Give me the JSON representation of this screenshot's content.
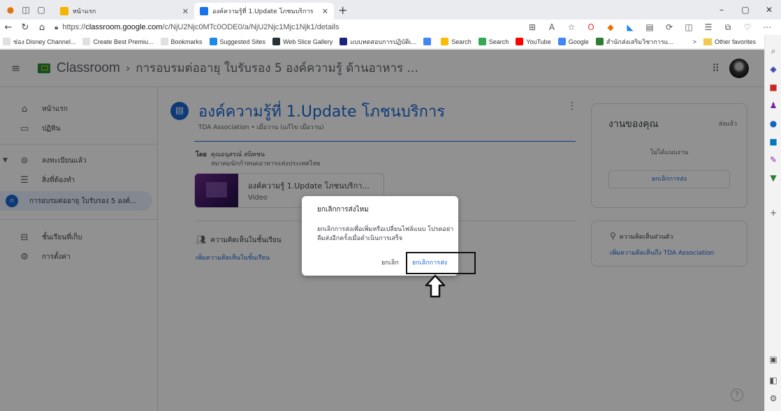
{
  "browser": {
    "tabs": [
      {
        "title": "หน้าแรก",
        "active": false,
        "color": "#f4b400"
      },
      {
        "title": "องค์ความรู้ที่ 1.Update โภชนบริการ",
        "active": true,
        "color": "#1a73e8"
      }
    ],
    "new_tab": "+",
    "url_prefix": "https://",
    "url_host": "classroom.google.com",
    "url_path": "/c/NjU2Njc0MTc0ODE0/a/NjU2Njc1Mjc1Njk1/details",
    "favorites": [
      {
        "label": "ช่อง Disney Channel...",
        "color": "#e0e0e0"
      },
      {
        "label": "Create Best Premiu...",
        "color": "#e0e0e0"
      },
      {
        "label": "Bookmarks",
        "color": "#e0e0e0"
      },
      {
        "label": "Suggested Sites",
        "color": "#1e88e5"
      },
      {
        "label": "Web Slice Gallery",
        "color": "#263238"
      },
      {
        "label": "แบบทดสอบการปฏิบัติเ...",
        "color": "#1a237e"
      },
      {
        "label": "",
        "color": "#4285f4"
      },
      {
        "label": "Search",
        "color": "#fbbc04"
      },
      {
        "label": "Search",
        "color": "#34a853"
      },
      {
        "label": "YouTube",
        "color": "#ff0000"
      },
      {
        "label": "Google",
        "color": "#4285f4"
      },
      {
        "label": "สำนักส่งเสริมวิชาการแ...",
        "color": "#2e7d32"
      }
    ],
    "fav_more": ">",
    "other_favorites": "Other favorites"
  },
  "classroom": {
    "brand": "Classroom",
    "breadcrumb": "การอบรมต่ออายุ ใบรับรอง 5 องค์ความรู้ ด้านอาหาร ..."
  },
  "sidebar": {
    "home": "หน้าแรก",
    "calendar": "ปฏิทิน",
    "enrolled": "ลงทะเบียนแล้ว",
    "todo": "สิ่งที่ต้องทำ",
    "class_initial": "ก",
    "class_name": "การอบรมต่ออายุ ใบรับรอง 5 องค์...",
    "archived": "ชั้นเรียนที่เก็บ",
    "settings": "การตั้งค่า"
  },
  "assignment": {
    "title": "องค์ความรู้ที่ 1.Update โภชนบริการ",
    "subtitle": "TDA Association • เมื่อวาน (แก้ไข เมื่อวาน)",
    "by_label": "โดย",
    "by_name": "คุณอนุสรณ์ สนิทชน",
    "org": "สมาคมนักกำหนดอาหารแห่งประเทศไทย",
    "attachment_title": "องค์ความรู้ 1.Update โภชนบริกา...",
    "attachment_type": "Video",
    "class_comments": "ความคิดเห็นในชั้นเรียน",
    "add_class_comment": "เพิ่มความคิดเห็นในชั้นเรียน"
  },
  "your_work": {
    "title": "งานของคุณ",
    "status": "ส่งแล้ว",
    "note": "ไม่ได้แนบงาน",
    "unsubmit_button": "ยกเลิกการส่ง"
  },
  "private_comments": {
    "title": "ความคิดเห็นส่วนตัว",
    "add_link": "เพิ่มความคิดเห็นถึง TDA Association"
  },
  "dialog": {
    "title": "ยกเลิกการส่งไหม",
    "body": "ยกเลิกการส่งเพื่อเพิ่มหรือเปลี่ยนไฟล์แนบ โปรดอย่าลืมส่งอีกครั้งเมื่อดำเนินการเสร็จ",
    "cancel": "ยกเลิก",
    "confirm": "ยกเลิกการส่ง"
  },
  "help_icon_label": "?"
}
